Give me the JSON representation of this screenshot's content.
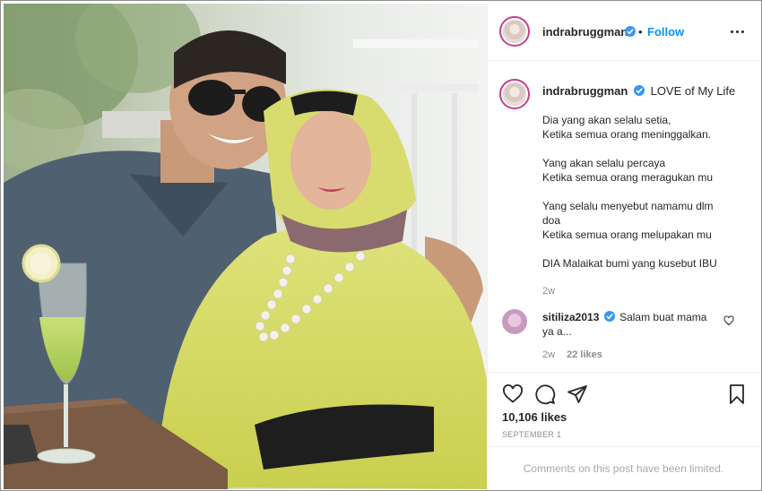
{
  "post": {
    "username": "indrabruggman",
    "follow_label": "Follow",
    "separator": "•",
    "caption": {
      "headline": "LOVE of My Life",
      "lines": [
        "Dia yang akan selalu setia,",
        "Ketika semua orang meninggalkan.",
        "",
        "Yang akan selalu percaya",
        "Ketika semua orang meragukan mu",
        "",
        "Yang selalu menyebut namamu dlm",
        "doa",
        "Ketika semua orang melupakan mu",
        "",
        "DIA Malaikat bumi yang kusebut IBU"
      ],
      "time": "2w"
    },
    "comment": {
      "username": "sitiliza2013",
      "text_line1": "Salam buat mama",
      "text_line2": "ya a...",
      "time": "2w",
      "likes": "22 likes"
    },
    "likes_count": "10,106 likes",
    "date": "SEPTEMBER 1",
    "comments_limited": "Comments on this post have been limited."
  },
  "icons": {
    "verified": "verified-badge-icon",
    "more": "more-options-icon",
    "like": "heart-icon",
    "comment": "comment-bubble-icon",
    "share": "paper-plane-icon",
    "save": "bookmark-icon"
  },
  "colors": {
    "follow_blue": "#0095f6",
    "verified_blue": "#3897f0",
    "story_ring": "#c63f8c",
    "muted_text": "#8e8e8e"
  }
}
